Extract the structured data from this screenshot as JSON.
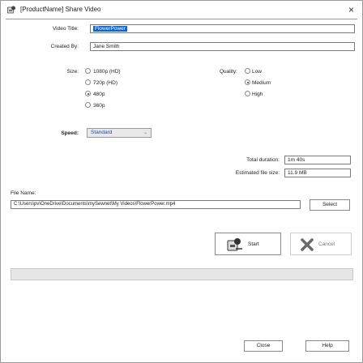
{
  "window": {
    "title": "[ProductName] Share Video",
    "close_glyph": "×"
  },
  "form": {
    "video_title_label": "Video Title:",
    "video_title_value": "FlowerPower",
    "created_by_label": "Created By:",
    "created_by_value": "Jane Smith",
    "size_label": "Size:",
    "size_options": [
      "1080p (HD)",
      "720p (HD)",
      "480p",
      "360p"
    ],
    "size_selected": "480p",
    "quality_label": "Quality:",
    "quality_options": [
      "Low",
      "Medium",
      "High"
    ],
    "quality_selected": "Medium",
    "speed_label": "Speed:",
    "speed_value": "Standard",
    "total_duration_label": "Total duration:",
    "total_duration_value": "1m 40s",
    "file_size_label": "Estimated file size:",
    "file_size_value": "11.9 MB",
    "file_name_label": "File Name:",
    "file_path_value": "C:\\Users\\pv\\OneDrive\\Documents\\mySewnet\\My Videos\\FlowerPower.mp4",
    "select_button": "Select",
    "start_button": "Start",
    "cancel_button": "Cancel",
    "close_button": "Close",
    "help_button": "Help"
  },
  "progress": {
    "value": 0
  },
  "icons": {
    "app": "app-icon",
    "start": "start-share-icon",
    "cancel": "cancel-x-icon"
  }
}
